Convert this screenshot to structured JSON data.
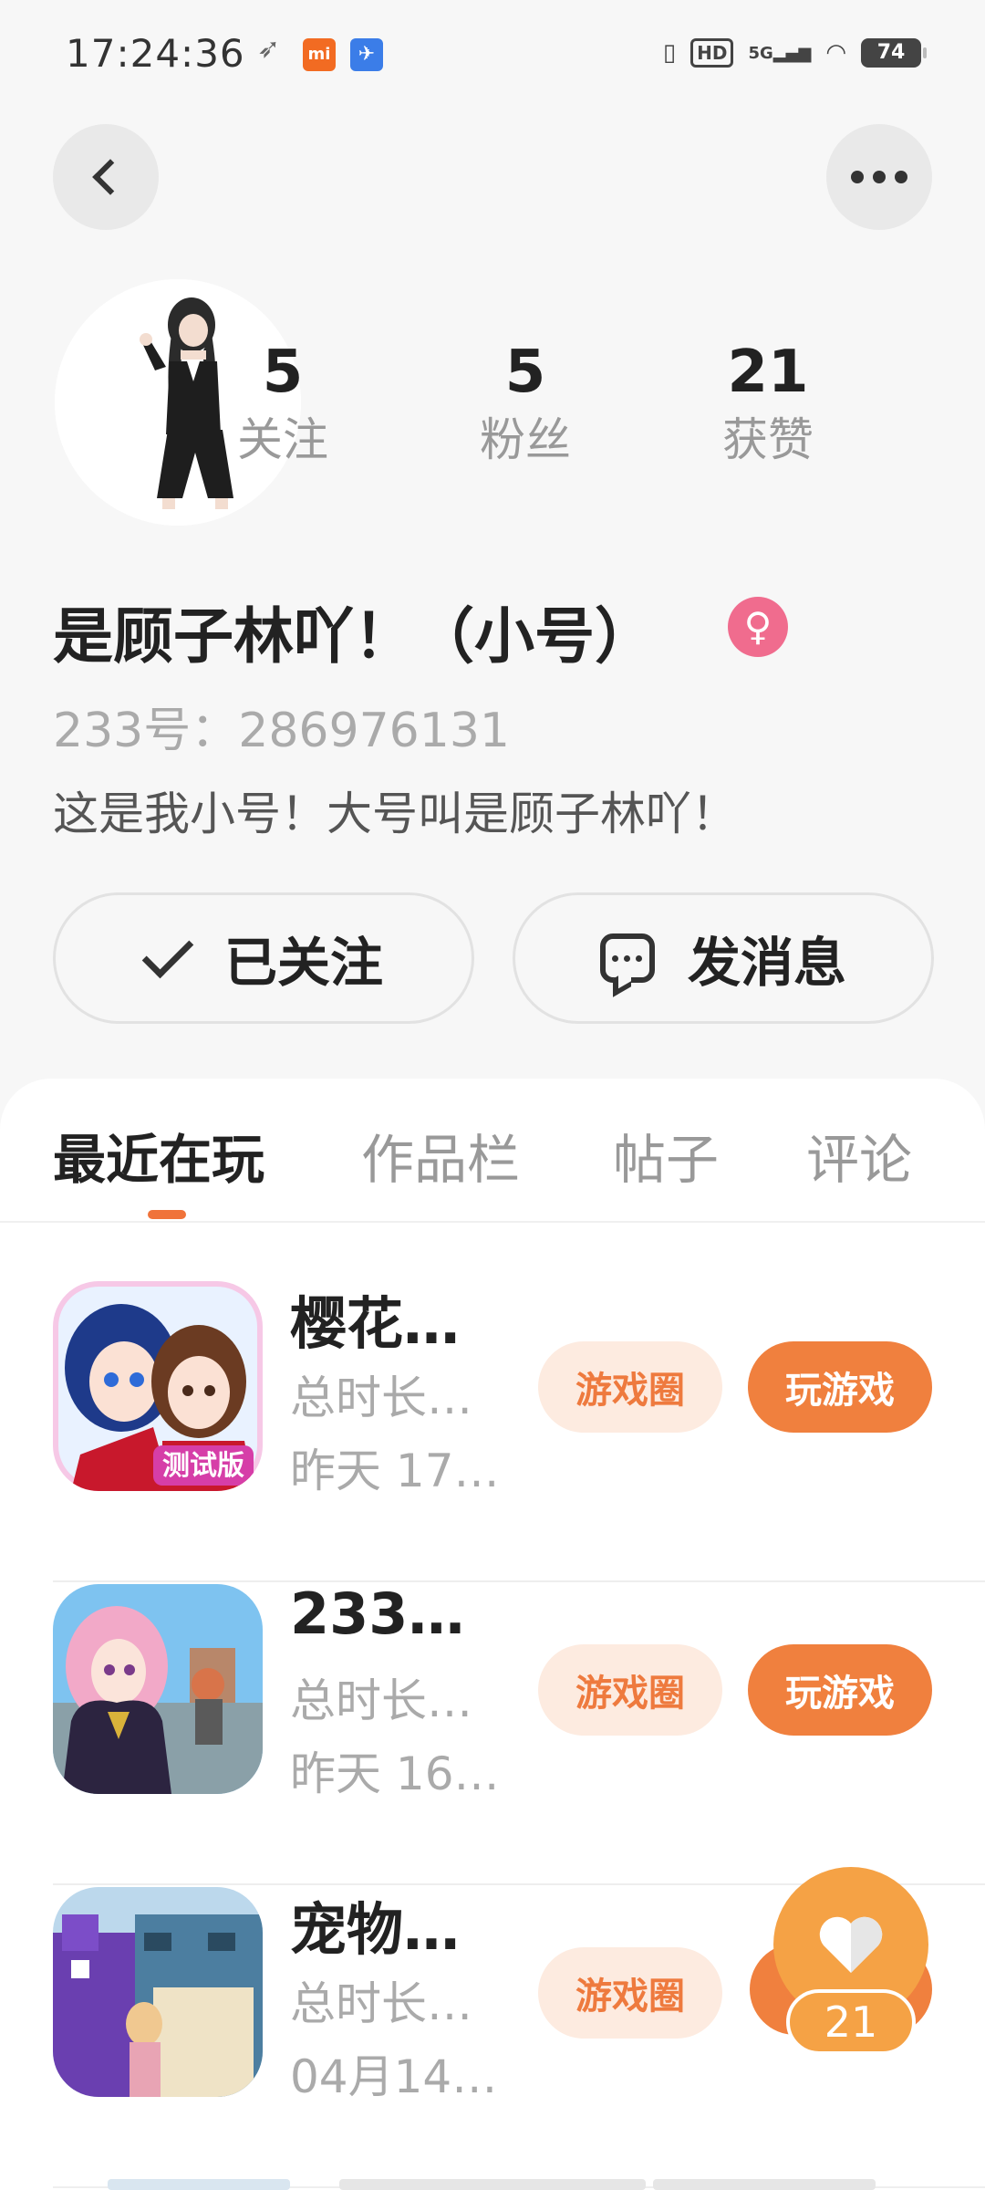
{
  "status_bar": {
    "time": "17:24:36",
    "app_icons": [
      "paper-plane-icon",
      "mi-icon",
      "bird-icon"
    ],
    "mi_label": "mi",
    "hd_label": "HD",
    "network_label": "5G",
    "battery": "74"
  },
  "profile": {
    "stats": [
      {
        "value": "5",
        "label": "关注"
      },
      {
        "value": "5",
        "label": "粉丝"
      },
      {
        "value": "21",
        "label": "获赞"
      }
    ],
    "username": "是顾子林吖！（小号）",
    "gender_symbol": "♀",
    "uid": "233号：286976131",
    "bio": "这是我小号！大号叫是顾子林吖！"
  },
  "actions": {
    "follow_label": "已关注",
    "message_label": "发消息"
  },
  "tabs": [
    "最近在玩",
    "作品栏",
    "帖子",
    "评论"
  ],
  "games": [
    {
      "title": "樱花…",
      "duration": "总时长…",
      "last_played": "昨天 17…",
      "circle_label": "游戏圈",
      "play_label": "玩游戏",
      "icon_badge": "测试版"
    },
    {
      "title": "233…",
      "duration": "总时长…",
      "last_played": "昨天 16…",
      "circle_label": "游戏圈",
      "play_label": "玩游戏"
    },
    {
      "title": "宠物…",
      "duration": "总时长…",
      "last_played": "04月14…",
      "circle_label": "游戏圈"
    }
  ],
  "floating_like": {
    "count": "21"
  },
  "colors": {
    "accent": "#f0803e",
    "accent_light": "#fdebe0",
    "gender": "#f06c8e"
  }
}
